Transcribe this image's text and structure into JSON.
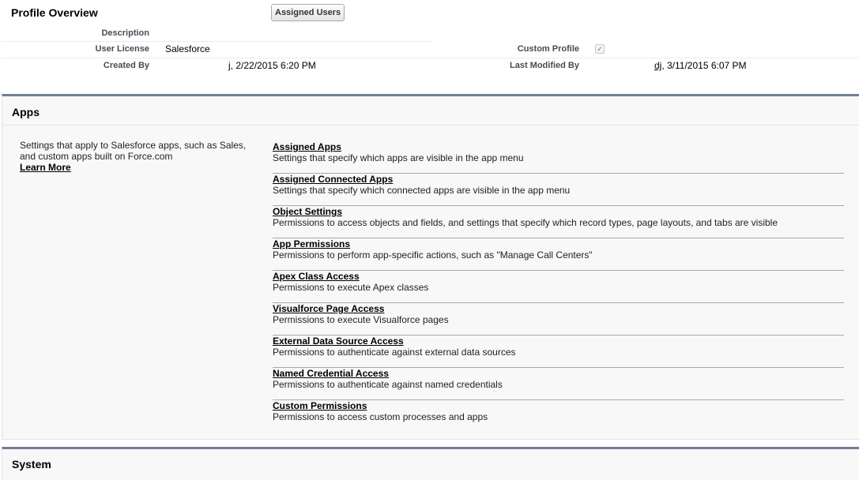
{
  "profile": {
    "title": "Profile Overview",
    "assigned_users_label": "Assigned Users",
    "description_label": "Description",
    "user_license_label": "User License",
    "user_license_value": "Salesforce",
    "custom_profile_label": "Custom Profile",
    "custom_profile_checked": true,
    "created_by_label": "Created By",
    "created_by_user": "j",
    "created_by_date": ", 2/22/2015 6:20 PM",
    "last_modified_by_label": "Last Modified By",
    "last_modified_by_user": "dj",
    "last_modified_by_date": ", 3/11/2015 6:07 PM"
  },
  "apps": {
    "title": "Apps",
    "description": "Settings that apply to Salesforce apps, such as Sales, and custom apps built on Force.com",
    "learn_more": "Learn More",
    "items": [
      {
        "label": "Assigned Apps",
        "description": "Settings that specify which apps are visible in the app menu"
      },
      {
        "label": "Assigned Connected Apps",
        "description": "Settings that specify which connected apps are visible in the app menu"
      },
      {
        "label": "Object Settings",
        "description": "Permissions to access objects and fields, and settings that specify which record types, page layouts, and tabs are visible"
      },
      {
        "label": "App Permissions",
        "description": "Permissions to perform app-specific actions, such as \"Manage Call Centers\""
      },
      {
        "label": "Apex Class Access",
        "description": "Permissions to execute Apex classes"
      },
      {
        "label": "Visualforce Page Access",
        "description": "Permissions to execute Visualforce pages"
      },
      {
        "label": "External Data Source Access",
        "description": "Permissions to authenticate against external data sources"
      },
      {
        "label": "Named Credential Access",
        "description": "Permissions to authenticate against named credentials"
      },
      {
        "label": "Custom Permissions",
        "description": "Permissions to access custom processes and apps"
      }
    ]
  },
  "system": {
    "title": "System"
  },
  "colors": {
    "section_border": "#747e96",
    "section_background": "#f8f8f8",
    "label_text": "#4a4a56"
  },
  "icons": {
    "checkbox": "checkmark-icon"
  }
}
